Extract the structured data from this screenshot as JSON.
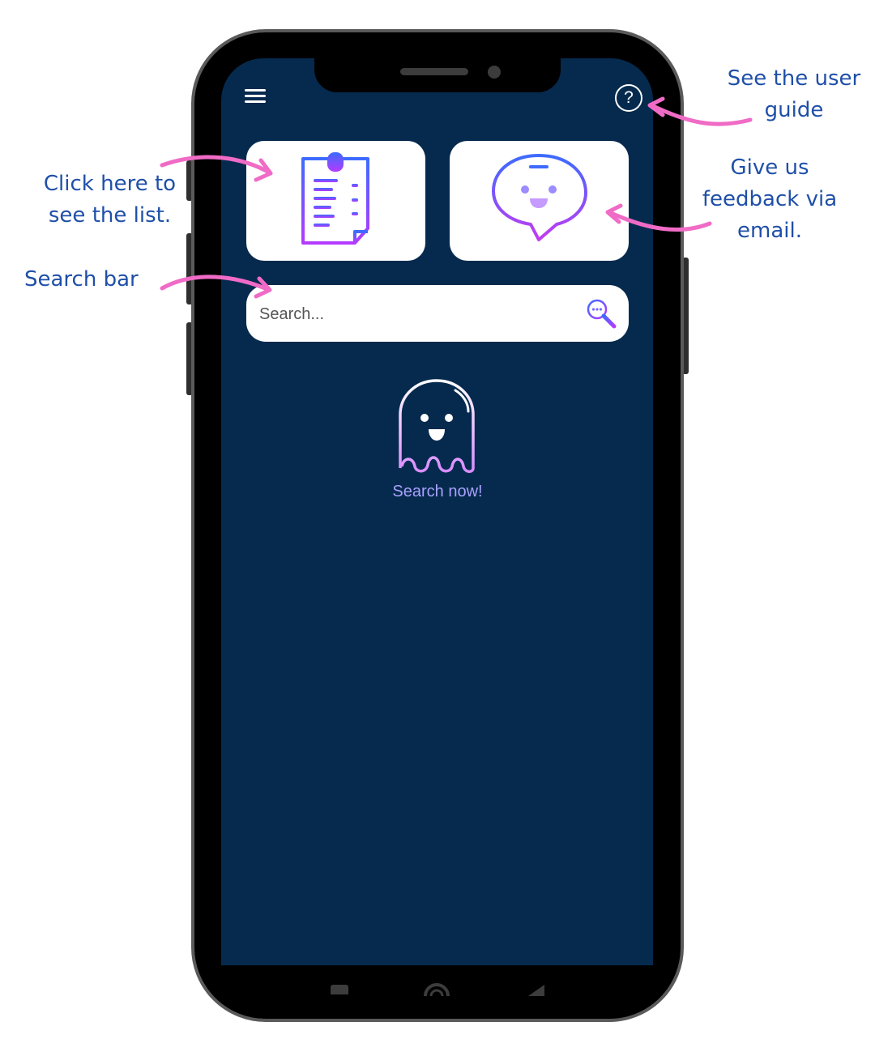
{
  "annotations": {
    "guide": "See the user guide",
    "feedback": "Give us feedback via email.",
    "list": "Click here to see the list.",
    "search": "Search bar"
  },
  "search": {
    "placeholder": "Search...",
    "value": ""
  },
  "empty_state": {
    "label": "Search now!"
  },
  "icons": {
    "menu": "hamburger-menu-icon",
    "help": "help-circle-icon",
    "list": "clipboard-list-icon",
    "feedback": "smiley-chat-bubble-icon",
    "search": "magnifier-chat-icon",
    "ghost": "ghost-icon",
    "help_glyph": "?"
  },
  "colors": {
    "screen_bg": "#062a4e",
    "annotation_text": "#1f4fa8",
    "arrow": "#f06bc6",
    "accent_blue": "#3d6bff",
    "accent_purple": "#b43aff",
    "empty_label": "#a9a1ff"
  }
}
